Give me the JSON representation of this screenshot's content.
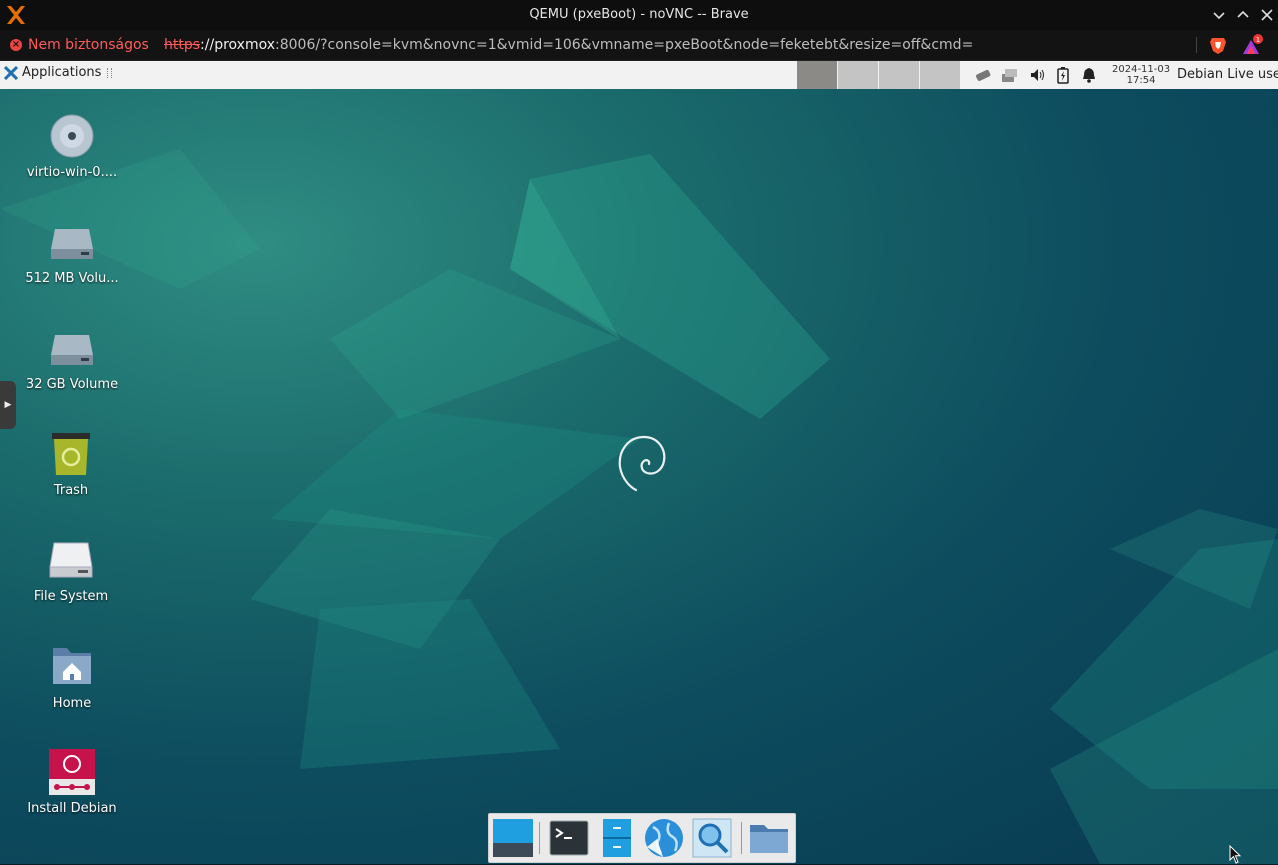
{
  "browser": {
    "window_title": "QEMU (pxeBoot) - noVNC -- Brave",
    "security_warning": "Nem biztonságos",
    "url_scheme": "https",
    "url_host": "://proxmox",
    "url_rest": ":8006/?console=kvm&novnc=1&vmid=106&vmname=pxeBoot&node=feketebt&resize=off&cmd=",
    "rewards_badge": "1"
  },
  "panel": {
    "applications_label": "Applications",
    "clock_date": "2024-11-03",
    "clock_time": "17:54",
    "user_label": "Debian Live user",
    "workspaces": [
      {
        "color": "#8c8a86",
        "active": true
      },
      {
        "color": "#c4c4c4",
        "active": false
      },
      {
        "color": "#c4c4c4",
        "active": false
      },
      {
        "color": "#c4c4c4",
        "active": false
      }
    ]
  },
  "desktop": {
    "icons": [
      {
        "label": "virtio-win-0....",
        "icon": "cd-disc-icon"
      },
      {
        "label": "512 MB Volu...",
        "icon": "drive-icon"
      },
      {
        "label": "32 GB Volume",
        "icon": "drive-icon"
      },
      {
        "label": "Trash",
        "icon": "trash-icon"
      },
      {
        "label": "File System",
        "icon": "harddisk-icon"
      },
      {
        "label": "Home",
        "icon": "home-folder-icon"
      },
      {
        "label": "Install Debian",
        "icon": "debian-installer-icon"
      }
    ]
  },
  "dock": {
    "items": [
      {
        "name": "show-desktop",
        "icon": "show-desktop-icon"
      },
      {
        "name": "terminal",
        "icon": "terminal-icon"
      },
      {
        "name": "file-manager",
        "icon": "file-manager-icon"
      },
      {
        "name": "web-browser",
        "icon": "web-browser-icon"
      },
      {
        "name": "app-finder",
        "icon": "search-icon"
      },
      {
        "name": "folder",
        "icon": "folder-icon"
      }
    ]
  },
  "colors": {
    "accent_warning": "#ff5b5b",
    "desktop_teal": "#1a6a6b"
  }
}
